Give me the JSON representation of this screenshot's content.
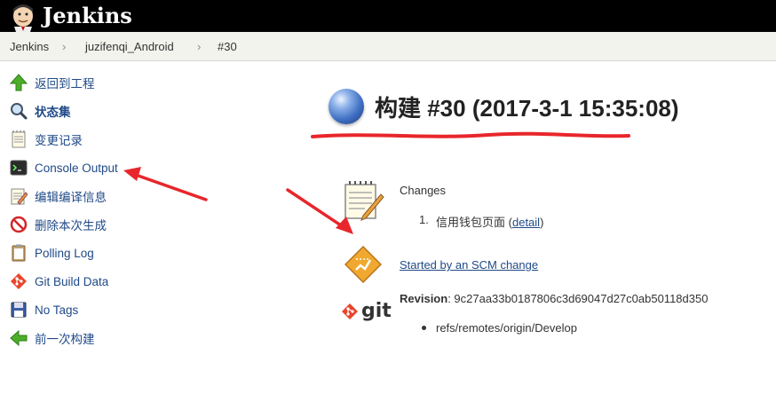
{
  "header": {
    "app_name": "Jenkins"
  },
  "breadcrumb": {
    "items": [
      "Jenkins",
      "juzifenqi_Android",
      "#30"
    ],
    "separator": "›"
  },
  "sidebar": {
    "items": [
      {
        "label": "返回到工程",
        "icon": "up-arrow-icon"
      },
      {
        "label": "状态集",
        "icon": "magnifier-icon",
        "active": true
      },
      {
        "label": "变更记录",
        "icon": "notepad-icon"
      },
      {
        "label": "Console Output",
        "icon": "terminal-icon"
      },
      {
        "label": "编辑编译信息",
        "icon": "notepad-edit-icon"
      },
      {
        "label": "删除本次生成",
        "icon": "no-entry-icon"
      },
      {
        "label": "Polling Log",
        "icon": "clipboard-icon"
      },
      {
        "label": "Git Build Data",
        "icon": "git-diamond-icon"
      },
      {
        "label": "No Tags",
        "icon": "floppy-icon"
      },
      {
        "label": "前一次构建",
        "icon": "left-arrow-icon"
      }
    ]
  },
  "build": {
    "title": "构建 #30 (2017-3-1 15:35:08)",
    "changes_heading": "Changes",
    "change_number": "1.",
    "change_message": "信用钱包页面",
    "change_open": "(",
    "change_link": "detail",
    "change_close": ")",
    "cause": "Started by an SCM change",
    "revision_label": "Revision",
    "revision_value": ": 9c27aa33b0187806c3d69047d27c0ab50118d350",
    "branch": "refs/remotes/origin/Develop",
    "git_label": "git"
  },
  "colors": {
    "link": "#204a87",
    "annotation": "#e8262b"
  }
}
